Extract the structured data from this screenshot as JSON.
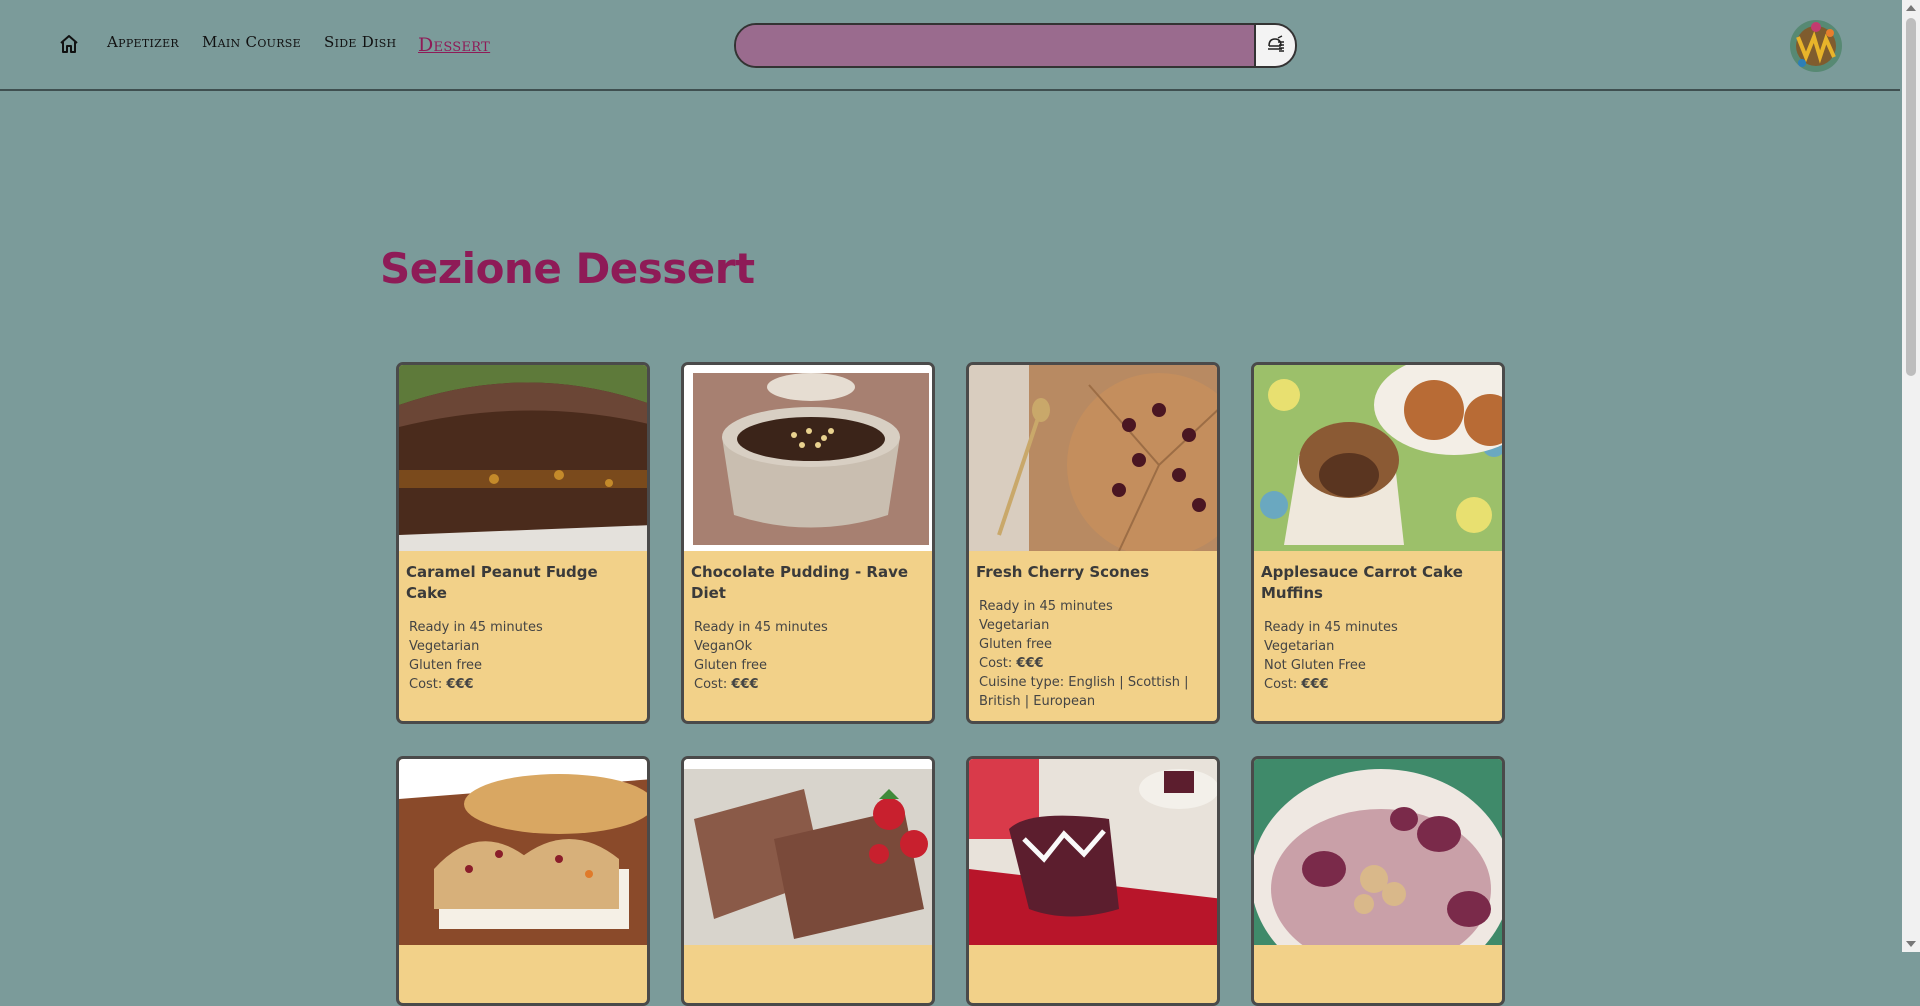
{
  "nav": {
    "home_icon": "home-icon",
    "links": [
      "Appetizer",
      "Main Course",
      "Side Dish",
      "Dessert"
    ],
    "active": "Dessert"
  },
  "search": {
    "placeholder": "",
    "button_icon": "recipe-search-icon"
  },
  "logo_icon": "brand-logo",
  "section": {
    "title": "Sezione Dessert"
  },
  "recipes": [
    {
      "title": "Caramel Peanut Fudge Cake",
      "ready": "Ready in 45 minutes",
      "diet": "Vegetarian",
      "gluten": "Gluten free",
      "cost_label": "Cost: ",
      "cost": "€€€",
      "cuisine": ""
    },
    {
      "title": "Chocolate Pudding - Rave Diet",
      "ready": "Ready in 45 minutes",
      "diet": "VeganOk",
      "gluten": "Gluten free",
      "cost_label": "Cost: ",
      "cost": "€€€",
      "cuisine": ""
    },
    {
      "title": "Fresh Cherry Scones",
      "ready": "Ready in 45 minutes",
      "diet": "Vegetarian",
      "gluten": "Gluten free",
      "cost_label": "Cost: ",
      "cost": "€€€",
      "cuisine": "Cuisine type: English | Scottish | British | European"
    },
    {
      "title": "Applesauce Carrot Cake Muffins",
      "ready": "Ready in 45 minutes",
      "diet": "Vegetarian",
      "gluten": "Not Gluten Free",
      "cost_label": "Cost: ",
      "cost": "€€€",
      "cuisine": ""
    }
  ],
  "colors": {
    "background": "#7b9b9a",
    "accent": "#8e1b57",
    "card": "#f2d189",
    "search": "#9a6b8e"
  }
}
